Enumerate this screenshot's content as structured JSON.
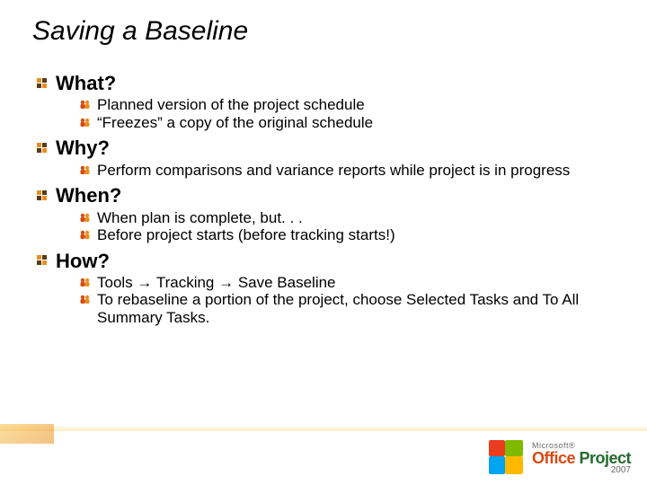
{
  "title": "Saving a Baseline",
  "sections": [
    {
      "heading": "What?",
      "items": [
        "Planned version of the project schedule",
        "“Freezes” a copy of the original schedule"
      ]
    },
    {
      "heading": "Why?",
      "items": [
        "Perform comparisons and variance reports while project is in progress"
      ]
    },
    {
      "heading": "When?",
      "items": [
        "When plan is complete, but. . .",
        "Before project starts (before tracking starts!)"
      ]
    },
    {
      "heading": "How?",
      "items": [
        "Tools → Tracking → Save Baseline",
        "To rebaseline a portion of the project, choose Selected Tasks and To All Summary Tasks."
      ]
    }
  ],
  "brand": {
    "top": "Microsoft®",
    "main_a": "Office ",
    "main_b": "Project",
    "year": "2007"
  }
}
